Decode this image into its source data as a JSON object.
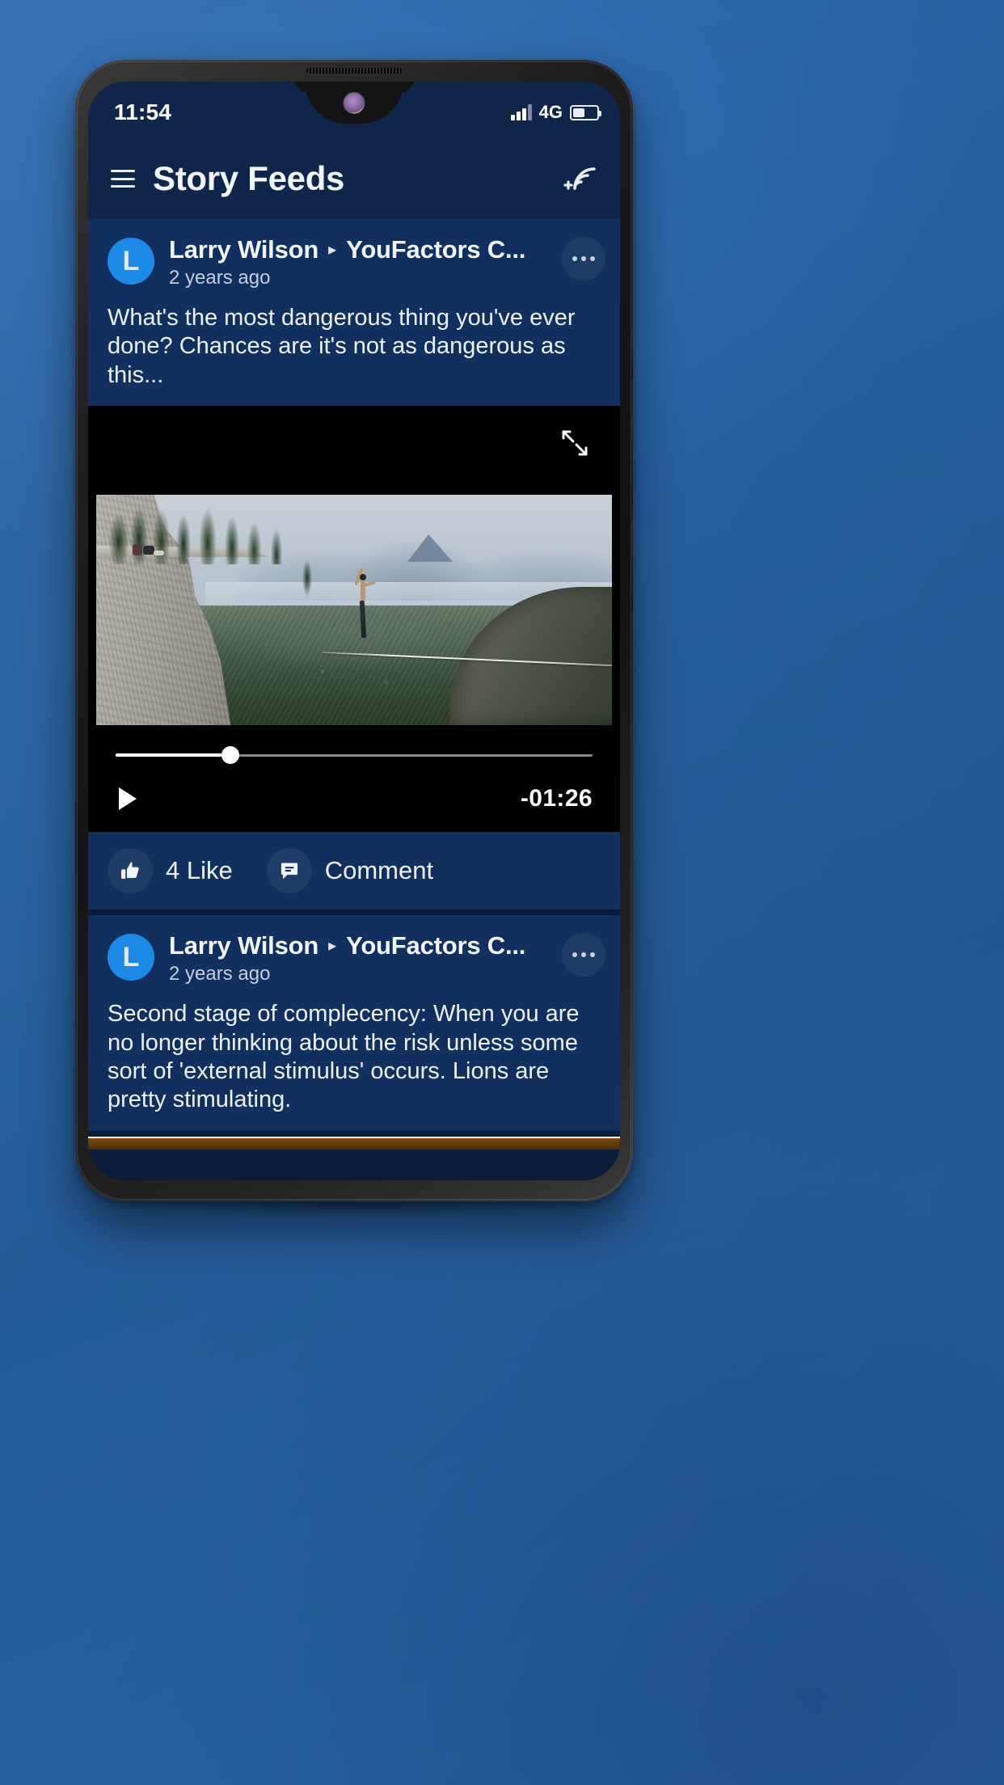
{
  "status_bar": {
    "time": "11:54",
    "network_label": "4G",
    "signal_icon": "signal-bars-icon",
    "battery_icon": "battery-icon",
    "battery_percent": 45
  },
  "app_bar": {
    "menu_icon": "hamburger-menu-icon",
    "title": "Story Feeds",
    "action_icon": "add-rss-feed-icon"
  },
  "feed": {
    "posts": [
      {
        "avatar_initial": "L",
        "author": "Larry Wilson",
        "separator": "▸",
        "channel": "YouFactors C...",
        "time_ago": "2 years ago",
        "more_icon": "more-options-icon",
        "body": "What's the most dangerous thing you've ever done? Chances are it's not as dangerous as this...",
        "media": {
          "expand_icon": "expand-fullscreen-icon",
          "player": {
            "play_icon": "play-icon",
            "time_remaining": "-01:26",
            "progress_percent": 24
          }
        },
        "actions": [
          {
            "icon": "thumbs-up-icon",
            "label": "4 Like"
          },
          {
            "icon": "comment-bubble-icon",
            "label": "Comment"
          }
        ]
      },
      {
        "avatar_initial": "L",
        "author": "Larry Wilson",
        "separator": "▸",
        "channel": "YouFactors C...",
        "time_ago": "2 years ago",
        "more_icon": "more-options-icon",
        "body": "Second stage of complecency: When you are no longer thinking about the risk unless some sort of 'external stimulus' occurs. Lions are pretty stimulating."
      }
    ]
  },
  "colors": {
    "backdrop_blue": "#2b66a8",
    "app_bar_navy": "#10254a",
    "card_navy": "#12305f",
    "avatar_blue": "#1e8ae8",
    "text_primary": "#f2f5fa",
    "text_secondary": "#c3cede",
    "player_black": "#000000"
  }
}
